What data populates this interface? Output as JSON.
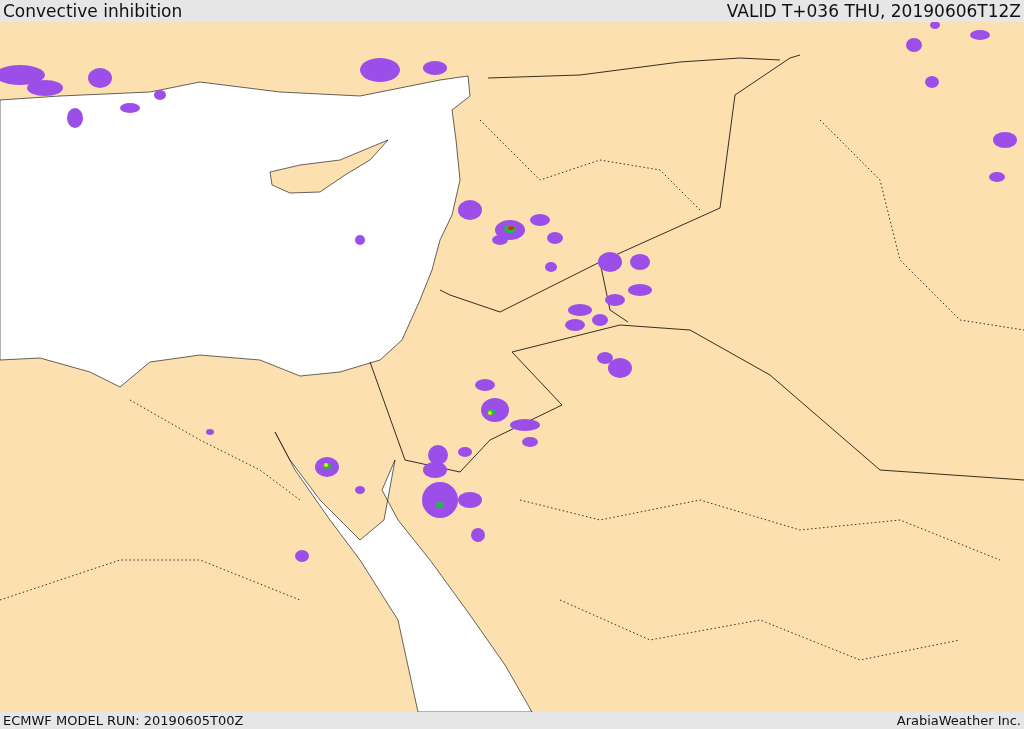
{
  "header": {
    "title": "Convective inhibition",
    "valid": "VALID T+036 THU, 20190606T12Z"
  },
  "footer": {
    "model_run": "ECMWF MODEL RUN: 20190605T00Z",
    "credit": "ArabiaWeather Inc."
  }
}
